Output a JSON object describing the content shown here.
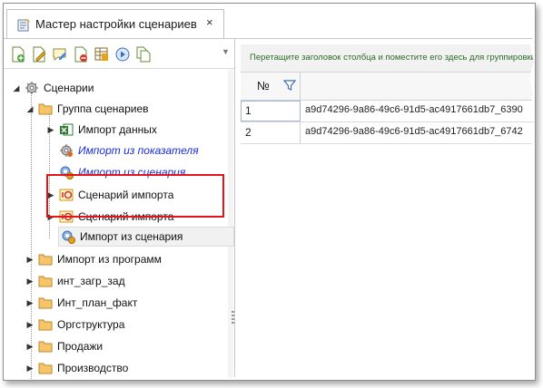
{
  "tab": {
    "title": "Мастер настройки сценариев",
    "close": "×",
    "icon": "wizard-icon"
  },
  "toolbar": {
    "buttons": [
      {
        "name": "add-scenario-button",
        "icon": "add-document-icon"
      },
      {
        "name": "edit-scenario-button",
        "icon": "edit-document-icon"
      },
      {
        "name": "rename-button",
        "icon": "comment-edit-icon"
      },
      {
        "name": "delete-button",
        "icon": "delete-document-icon"
      },
      {
        "name": "properties-button",
        "icon": "table-properties-icon"
      },
      {
        "name": "run-button",
        "icon": "play-circle-icon"
      },
      {
        "name": "copy-button",
        "icon": "copy-document-icon"
      }
    ],
    "more": "▼"
  },
  "tree": {
    "root": {
      "label": "Сценарии",
      "icon": "gear-icon"
    },
    "group": {
      "label": "Группа сценариев",
      "icon": "folder-icon"
    },
    "items": [
      {
        "label": "Импорт данных",
        "icon": "excel-icon"
      },
      {
        "label": "Импорт из показателя",
        "icon": "gear-icon"
      },
      {
        "label": "Импорт из сценария",
        "icon": "gear-cog-icon"
      },
      {
        "label": "Сценарий импорта",
        "icon": "1c-icon"
      },
      {
        "label": "Сценарий импорта",
        "icon": "1c-icon"
      },
      {
        "label": "Импорт из сценария",
        "icon": "gear-cog-icon"
      }
    ],
    "folders": [
      {
        "label": "Импорт из программ"
      },
      {
        "label": "инт_загр_зад"
      },
      {
        "label": "Инт_план_факт"
      },
      {
        "label": "Оргструктура"
      },
      {
        "label": "Продажи"
      },
      {
        "label": "Производство"
      }
    ]
  },
  "grid": {
    "group_hint": "Перетащите заголовок столбца и поместите его здесь для группировки",
    "column_no": "№",
    "rows": [
      {
        "no": "1",
        "id": "a9d74296-9a86-49c6-91d5-ac4917661db7_6390"
      },
      {
        "no": "2",
        "id": "a9d74296-9a86-49c6-91d5-ac4917661db7_6742"
      }
    ]
  },
  "colors": {
    "highlight": "#e2141a",
    "link": "#1a2dd8",
    "hint_text": "#2b6a25"
  }
}
